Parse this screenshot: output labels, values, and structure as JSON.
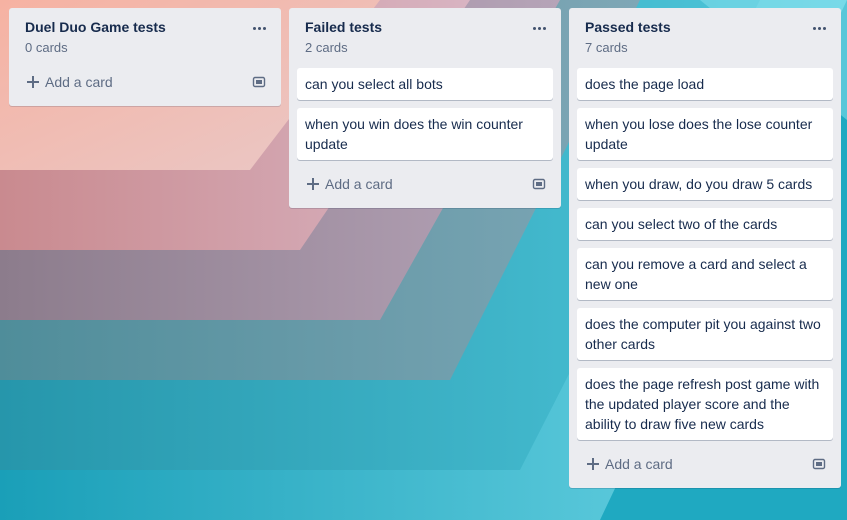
{
  "lists": [
    {
      "title": "Duel Duo Game tests",
      "count": "0 cards",
      "cards": [],
      "add_label": "Add a card"
    },
    {
      "title": "Failed tests",
      "count": "2 cards",
      "cards": [
        "can you select all bots",
        "when you win does the win counter update"
      ],
      "add_label": "Add a card"
    },
    {
      "title": "Passed tests",
      "count": "7 cards",
      "cards": [
        "does the page load",
        "when you lose does the lose counter update",
        "when you draw, do you draw 5 cards",
        "can you select two of the cards",
        "can you remove a card and select a new one",
        "does the computer pit you against two other cards",
        "does the page refresh post game with the updated player score and the ability to draw five new cards"
      ],
      "add_label": "Add a card"
    }
  ],
  "icons": {
    "menu": "more-horizontal-icon",
    "add": "plus-icon",
    "template": "card-template-icon"
  },
  "colors": {
    "list_bg": "#ebecf0",
    "text": "#172b4d",
    "muted": "#5e6c84"
  }
}
